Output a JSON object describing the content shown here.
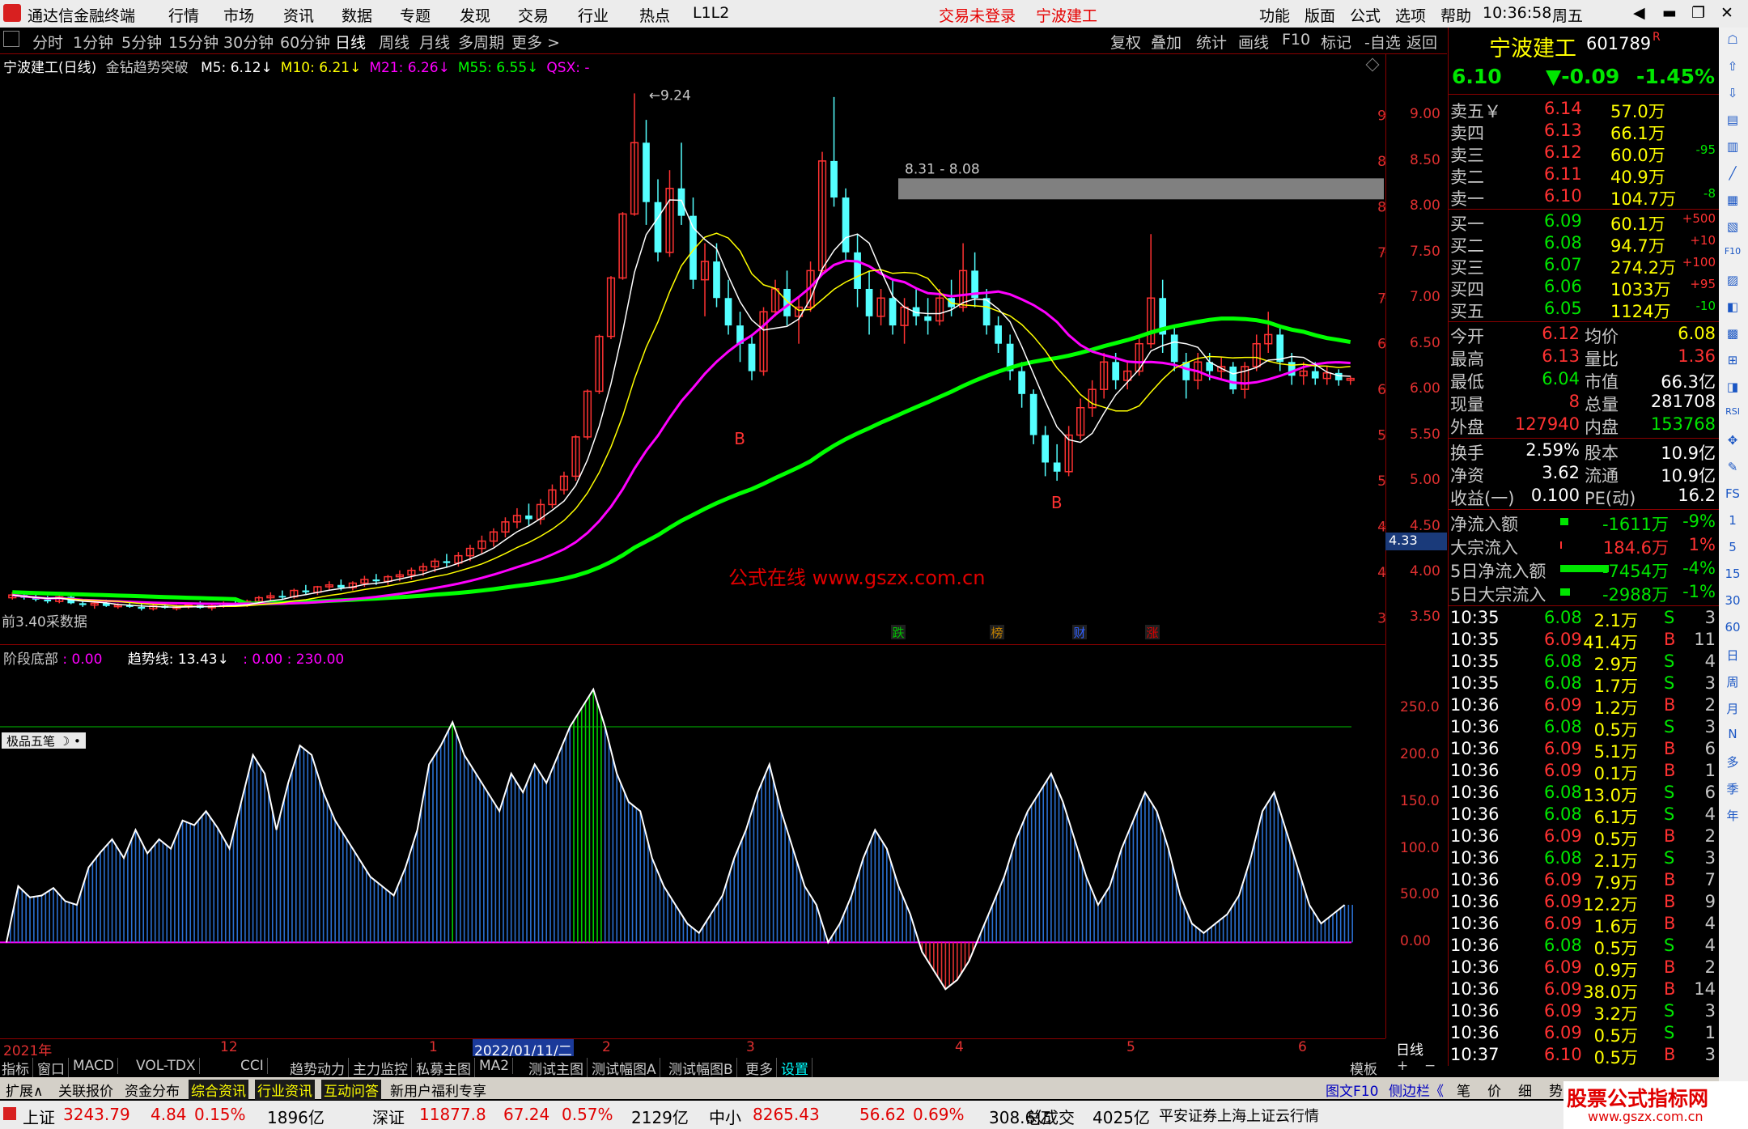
{
  "window": {
    "app_title": "通达信金融终端",
    "menus": [
      "行情",
      "市场",
      "资讯",
      "数据",
      "专题",
      "发现",
      "交易",
      "行业",
      "热点",
      "L1L2"
    ],
    "login_status": "交易未登录",
    "stock_name_title": "宁波建工",
    "right_menus": [
      "功能",
      "版面",
      "公式",
      "选项",
      "帮助"
    ],
    "time": "10:36:58",
    "weekday": "周五",
    "window_controls": [
      "◀",
      "▬",
      "❐",
      "✕"
    ]
  },
  "toolbar": {
    "periods": [
      "分时",
      "1分钟",
      "5分钟",
      "15分钟",
      "30分钟",
      "60分钟",
      "日线",
      "周线",
      "月线",
      "多周期",
      "更多 >"
    ],
    "active_period": "日线",
    "actions": [
      "复权",
      "叠加",
      "统计",
      "画线",
      "F10",
      "标记",
      "-自选",
      "返回"
    ]
  },
  "main_chart": {
    "legend_title": "宁波建工(日线)",
    "indicator_name": "金钻趋势突破",
    "ma": [
      {
        "label": "M5: 6.12↓",
        "color": "#ffffff"
      },
      {
        "label": "M10: 6.21↓",
        "color": "#ffff00"
      },
      {
        "label": "M21: 6.26↓",
        "color": "#ff00ff"
      },
      {
        "label": "M55: 6.55↓",
        "color": "#00ff00"
      },
      {
        "label": "QSX: -",
        "color": "#ff00ff"
      }
    ],
    "peak_label": "9.24",
    "range_label": "8.31 - 8.08",
    "b_marks": [
      "B",
      "B"
    ],
    "watermark": "公式在线  www.gszx.com.cn",
    "bottom_label": "前3.40采数据",
    "price_tag": "4.33",
    "events": [
      {
        "label": "跌",
        "color": "#00c000"
      },
      {
        "label": "榜",
        "color": "#c08000"
      },
      {
        "label": "财",
        "color": "#3060ff"
      },
      {
        "label": "涨",
        "color": "#e00000"
      }
    ],
    "y_ticks": [
      "9.00",
      "8.50",
      "8.00",
      "7.50",
      "7.00",
      "6.50",
      "6.00",
      "5.50",
      "5.00",
      "4.50",
      "4.00",
      "3.50"
    ]
  },
  "sub_chart": {
    "legend_name": "阶段底部",
    "legend_value": ": 0.00",
    "trend_label": "趋势线: 13.43↓",
    "extra": ": 0.00 : 230.00",
    "y_ticks": [
      "250.0",
      "200.0",
      "150.0",
      "100.0",
      "50.00",
      "0.00"
    ],
    "widget_label": "极品五笔"
  },
  "time_axis": [
    "2021年",
    "12",
    "1",
    "2022/01/11/二",
    "2",
    "3",
    "4",
    "5",
    "6"
  ],
  "period_box": "日线",
  "bottom_tabs": [
    "指标",
    "窗口",
    "MACD",
    "VOL-TDX",
    "CCI",
    "趋势动力",
    "主力监控",
    "私募主图",
    "MA2",
    "测试主图",
    "测试幅图A",
    "测试幅图B",
    "更多",
    "设置"
  ],
  "bottom_tabs_right": [
    "模板",
    "+",
    "−"
  ],
  "info_tabs": [
    "扩展∧",
    "关联报价",
    "资金分布",
    "综合资讯",
    "行业资讯",
    "互动问答",
    "新用户福利专享"
  ],
  "info_right": [
    "图文F10",
    "侧边栏《",
    "笔",
    "价",
    "细",
    "势"
  ],
  "quote": {
    "name": "宁波建工",
    "code": "601789",
    "flag": "R",
    "price": "6.10",
    "change": "▼-0.09",
    "pct": "-1.45%",
    "asks": [
      {
        "label": "卖五￥",
        "price": "6.14",
        "vol": "57.0万",
        "chg": ""
      },
      {
        "label": "卖四",
        "price": "6.13",
        "vol": "66.1万",
        "chg": ""
      },
      {
        "label": "卖三",
        "price": "6.12",
        "vol": "60.0万",
        "chg": "-95"
      },
      {
        "label": "卖二",
        "price": "6.11",
        "vol": "40.9万",
        "chg": ""
      },
      {
        "label": "卖一",
        "price": "6.10",
        "vol": "104.7万",
        "chg": "-8"
      }
    ],
    "bids": [
      {
        "label": "买一",
        "price": "6.09",
        "vol": "60.1万",
        "chg": "+500"
      },
      {
        "label": "买二",
        "price": "6.08",
        "vol": "94.7万",
        "chg": "+10"
      },
      {
        "label": "买三",
        "price": "6.07",
        "vol": "274.2万",
        "chg": "+100"
      },
      {
        "label": "买四",
        "price": "6.06",
        "vol": "1033万",
        "chg": "+95"
      },
      {
        "label": "买五",
        "price": "6.05",
        "vol": "1124万",
        "chg": "-10"
      }
    ],
    "stats": [
      {
        "l1": "今开",
        "v1": "6.12",
        "c1": "red",
        "l2": "均价",
        "v2": "6.08",
        "c2": "yellow"
      },
      {
        "l1": "最高",
        "v1": "6.13",
        "c1": "red",
        "l2": "量比",
        "v2": "1.36",
        "c2": "red"
      },
      {
        "l1": "最低",
        "v1": "6.04",
        "c1": "green",
        "l2": "市值",
        "v2": "66.3亿",
        "c2": "white"
      },
      {
        "l1": "现量",
        "v1": "8",
        "c1": "red",
        "l2": "总量",
        "v2": "281708",
        "c2": "white"
      },
      {
        "l1": "外盘",
        "v1": "127940",
        "c1": "red",
        "l2": "内盘",
        "v2": "153768",
        "c2": "green"
      }
    ],
    "stats2": [
      {
        "l1": "换手",
        "v1": "2.59%",
        "l2": "股本",
        "v2": "10.9亿"
      },
      {
        "l1": "净资",
        "v1": "3.62",
        "l2": "流通",
        "v2": "10.9亿"
      },
      {
        "l1": "收益(一)",
        "v1": "0.100",
        "l2": "PE(动)",
        "v2": "16.2"
      }
    ],
    "flows": [
      {
        "label": "净流入额",
        "val": "-1611万",
        "pct": "-9%",
        "bar": 10,
        "color": "green"
      },
      {
        "label": "大宗流入",
        "val": "184.6万",
        "pct": "1%",
        "bar": 2,
        "color": "red"
      },
      {
        "label": "5日净流入额",
        "val": "-7454万",
        "pct": "-4%",
        "bar": 60,
        "color": "green"
      },
      {
        "label": "5日大宗流入",
        "val": "-2988万",
        "pct": "-1%",
        "bar": 12,
        "color": "green"
      }
    ],
    "ticks": [
      {
        "t": "10:35",
        "p": "6.08",
        "v": "2.1万",
        "bs": "S",
        "n": "3"
      },
      {
        "t": "10:35",
        "p": "6.09",
        "v": "41.4万",
        "bs": "B",
        "n": "11"
      },
      {
        "t": "10:35",
        "p": "6.08",
        "v": "2.9万",
        "bs": "S",
        "n": "4"
      },
      {
        "t": "10:35",
        "p": "6.08",
        "v": "1.7万",
        "bs": "S",
        "n": "3"
      },
      {
        "t": "10:36",
        "p": "6.09",
        "v": "1.2万",
        "bs": "B",
        "n": "2"
      },
      {
        "t": "10:36",
        "p": "6.08",
        "v": "0.5万",
        "bs": "S",
        "n": "3"
      },
      {
        "t": "10:36",
        "p": "6.09",
        "v": "5.1万",
        "bs": "B",
        "n": "6"
      },
      {
        "t": "10:36",
        "p": "6.09",
        "v": "0.1万",
        "bs": "B",
        "n": "1"
      },
      {
        "t": "10:36",
        "p": "6.08",
        "v": "13.0万",
        "bs": "S",
        "n": "6"
      },
      {
        "t": "10:36",
        "p": "6.08",
        "v": "6.1万",
        "bs": "S",
        "n": "4"
      },
      {
        "t": "10:36",
        "p": "6.09",
        "v": "0.5万",
        "bs": "B",
        "n": "2"
      },
      {
        "t": "10:36",
        "p": "6.08",
        "v": "2.1万",
        "bs": "S",
        "n": "3"
      },
      {
        "t": "10:36",
        "p": "6.09",
        "v": "7.9万",
        "bs": "B",
        "n": "7"
      },
      {
        "t": "10:36",
        "p": "6.09",
        "v": "12.2万",
        "bs": "B",
        "n": "9"
      },
      {
        "t": "10:36",
        "p": "6.09",
        "v": "1.6万",
        "bs": "B",
        "n": "4"
      },
      {
        "t": "10:36",
        "p": "6.08",
        "v": "0.5万",
        "bs": "S",
        "n": "4"
      },
      {
        "t": "10:36",
        "p": "6.09",
        "v": "0.9万",
        "bs": "B",
        "n": "2"
      },
      {
        "t": "10:36",
        "p": "6.09",
        "v": "38.0万",
        "bs": "B",
        "n": "14"
      },
      {
        "t": "10:36",
        "p": "6.09",
        "v": "3.2万",
        "bs": "S",
        "n": "3"
      },
      {
        "t": "10:36",
        "p": "6.09",
        "v": "0.5万",
        "bs": "S",
        "n": "1"
      },
      {
        "t": "10:37",
        "p": "6.10",
        "v": "0.5万",
        "bs": "B",
        "n": "3"
      }
    ]
  },
  "side_icons": [
    "☖",
    "⇧",
    "⇩",
    "▤",
    "▥",
    "╱",
    "▦",
    "▧",
    "F10",
    "▨",
    "◧",
    "▩",
    "⊞",
    "◨",
    "RSI",
    "✥",
    "✎",
    "FS",
    "1",
    "5",
    "15",
    "30",
    "60",
    "日",
    "周",
    "月",
    "N",
    "多",
    "季",
    "年"
  ],
  "status_bar": {
    "items": [
      {
        "name": "上证",
        "val": "3243.79",
        "chg": "4.84",
        "pct": "0.15%",
        "amt": "1896亿"
      },
      {
        "name": "深证",
        "val": "11877.8",
        "chg": "67.24",
        "pct": "0.57%",
        "amt": "2129亿"
      },
      {
        "name": "中小",
        "val": "8265.43",
        "chg": "56.62",
        "pct": "0.69%",
        "amt": "308.6亿"
      }
    ],
    "total_label": "总成交",
    "total": "4025亿",
    "server": "平安证券上海上证云行情",
    "logo_text": "股票公式指标网",
    "logo_url": "www.gszx.com.cn"
  },
  "chart_data": {
    "type": "candlestick",
    "ylim": [
      3.3,
      9.5
    ],
    "candles": [
      [
        3.72,
        3.78,
        3.7,
        3.75
      ],
      [
        3.75,
        3.77,
        3.7,
        3.72
      ],
      [
        3.72,
        3.76,
        3.68,
        3.7
      ],
      [
        3.7,
        3.74,
        3.66,
        3.68
      ],
      [
        3.68,
        3.75,
        3.66,
        3.73
      ],
      [
        3.73,
        3.76,
        3.65,
        3.66
      ],
      [
        3.66,
        3.7,
        3.62,
        3.64
      ],
      [
        3.64,
        3.68,
        3.6,
        3.66
      ],
      [
        3.66,
        3.7,
        3.62,
        3.63
      ],
      [
        3.63,
        3.66,
        3.6,
        3.64
      ],
      [
        3.64,
        3.68,
        3.61,
        3.62
      ],
      [
        3.62,
        3.66,
        3.58,
        3.6
      ],
      [
        3.6,
        3.65,
        3.58,
        3.63
      ],
      [
        3.63,
        3.67,
        3.6,
        3.61
      ],
      [
        3.61,
        3.64,
        3.58,
        3.62
      ],
      [
        3.62,
        3.66,
        3.6,
        3.64
      ],
      [
        3.64,
        3.68,
        3.6,
        3.61
      ],
      [
        3.61,
        3.65,
        3.58,
        3.63
      ],
      [
        3.63,
        3.68,
        3.61,
        3.66
      ],
      [
        3.66,
        3.7,
        3.62,
        3.64
      ],
      [
        3.64,
        3.7,
        3.62,
        3.68
      ],
      [
        3.68,
        3.74,
        3.65,
        3.72
      ],
      [
        3.72,
        3.78,
        3.68,
        3.74
      ],
      [
        3.74,
        3.8,
        3.7,
        3.73
      ],
      [
        3.73,
        3.82,
        3.71,
        3.8
      ],
      [
        3.8,
        3.86,
        3.76,
        3.78
      ],
      [
        3.78,
        3.85,
        3.75,
        3.84
      ],
      [
        3.84,
        3.9,
        3.8,
        3.86
      ],
      [
        3.86,
        3.92,
        3.8,
        3.83
      ],
      [
        3.83,
        3.9,
        3.8,
        3.88
      ],
      [
        3.88,
        3.96,
        3.84,
        3.92
      ],
      [
        3.92,
        3.98,
        3.86,
        3.9
      ],
      [
        3.9,
        3.97,
        3.86,
        3.95
      ],
      [
        3.95,
        4.02,
        3.9,
        3.97
      ],
      [
        3.97,
        4.05,
        3.92,
        4.02
      ],
      [
        4.02,
        4.1,
        3.96,
        4.06
      ],
      [
        4.06,
        4.15,
        4.0,
        4.12
      ],
      [
        4.12,
        4.2,
        4.05,
        4.1
      ],
      [
        4.1,
        4.22,
        4.06,
        4.18
      ],
      [
        4.18,
        4.3,
        4.12,
        4.26
      ],
      [
        4.26,
        4.4,
        4.2,
        4.34
      ],
      [
        4.34,
        4.48,
        4.28,
        4.44
      ],
      [
        4.44,
        4.6,
        4.38,
        4.55
      ],
      [
        4.55,
        4.7,
        4.48,
        4.62
      ],
      [
        4.62,
        4.75,
        4.5,
        4.58
      ],
      [
        4.58,
        4.8,
        4.52,
        4.74
      ],
      [
        4.74,
        4.96,
        4.7,
        4.9
      ],
      [
        4.9,
        5.1,
        4.85,
        5.05
      ],
      [
        5.05,
        5.5,
        5.0,
        5.48
      ],
      [
        5.48,
        6.0,
        5.45,
        5.98
      ],
      [
        5.98,
        6.6,
        5.95,
        6.58
      ],
      [
        6.58,
        7.24,
        6.55,
        7.22
      ],
      [
        7.22,
        7.94,
        7.2,
        7.92
      ],
      [
        7.92,
        9.24,
        7.9,
        8.7
      ],
      [
        8.7,
        8.95,
        7.8,
        8.05
      ],
      [
        8.05,
        8.3,
        7.4,
        7.5
      ],
      [
        7.5,
        8.4,
        7.45,
        8.2
      ],
      [
        8.2,
        8.7,
        7.8,
        7.9
      ],
      [
        7.9,
        8.1,
        7.1,
        7.2
      ],
      [
        7.2,
        7.6,
        6.8,
        7.4
      ],
      [
        7.4,
        7.6,
        6.9,
        7.0
      ],
      [
        7.0,
        7.2,
        6.6,
        6.7
      ],
      [
        6.7,
        6.85,
        6.3,
        6.5
      ],
      [
        6.5,
        6.6,
        6.1,
        6.2
      ],
      [
        6.2,
        6.9,
        6.15,
        6.85
      ],
      [
        6.85,
        7.2,
        6.8,
        7.1
      ],
      [
        7.1,
        7.3,
        6.7,
        6.8
      ],
      [
        6.8,
        7.0,
        6.5,
        6.9
      ],
      [
        6.9,
        7.4,
        6.85,
        7.3
      ],
      [
        7.3,
        8.6,
        7.25,
        8.5
      ],
      [
        8.5,
        9.2,
        8.0,
        8.1
      ],
      [
        8.1,
        8.2,
        7.4,
        7.5
      ],
      [
        7.5,
        7.7,
        6.9,
        7.1
      ],
      [
        7.1,
        7.3,
        6.6,
        6.8
      ],
      [
        6.8,
        7.1,
        6.7,
        7.0
      ],
      [
        7.0,
        7.2,
        6.6,
        6.7
      ],
      [
        6.7,
        7.0,
        6.5,
        6.9
      ],
      [
        6.9,
        7.1,
        6.7,
        6.8
      ],
      [
        6.8,
        7.0,
        6.6,
        6.75
      ],
      [
        6.75,
        7.1,
        6.7,
        7.0
      ],
      [
        7.0,
        7.2,
        6.8,
        6.9
      ],
      [
        6.9,
        7.6,
        6.85,
        7.3
      ],
      [
        7.3,
        7.5,
        6.9,
        7.0
      ],
      [
        7.0,
        7.1,
        6.6,
        6.7
      ],
      [
        6.7,
        6.8,
        6.4,
        6.5
      ],
      [
        6.5,
        6.6,
        6.1,
        6.2
      ],
      [
        6.2,
        6.3,
        5.8,
        5.95
      ],
      [
        5.95,
        6.0,
        5.4,
        5.5
      ],
      [
        5.5,
        5.6,
        5.05,
        5.2
      ],
      [
        5.2,
        5.4,
        5.0,
        5.1
      ],
      [
        5.1,
        5.6,
        5.05,
        5.5
      ],
      [
        5.5,
        5.9,
        5.45,
        5.8
      ],
      [
        5.8,
        6.1,
        5.7,
        6.0
      ],
      [
        6.0,
        6.4,
        5.9,
        6.3
      ],
      [
        6.3,
        6.4,
        6.0,
        6.1
      ],
      [
        6.1,
        6.3,
        6.0,
        6.2
      ],
      [
        6.2,
        6.6,
        6.15,
        6.5
      ],
      [
        6.5,
        7.7,
        6.45,
        7.0
      ],
      [
        7.0,
        7.2,
        6.4,
        6.6
      ],
      [
        6.6,
        6.7,
        6.2,
        6.3
      ],
      [
        6.3,
        6.4,
        5.9,
        6.1
      ],
      [
        6.1,
        6.4,
        6.0,
        6.3
      ],
      [
        6.3,
        6.4,
        6.1,
        6.2
      ],
      [
        6.2,
        6.35,
        6.1,
        6.25
      ],
      [
        6.25,
        6.3,
        5.95,
        6.0
      ],
      [
        6.0,
        6.3,
        5.9,
        6.25
      ],
      [
        6.25,
        6.6,
        6.2,
        6.5
      ],
      [
        6.5,
        6.85,
        6.4,
        6.6
      ],
      [
        6.6,
        6.7,
        6.2,
        6.3
      ],
      [
        6.3,
        6.4,
        6.05,
        6.15
      ],
      [
        6.15,
        6.3,
        6.05,
        6.2
      ],
      [
        6.2,
        6.3,
        6.05,
        6.12
      ],
      [
        6.12,
        6.25,
        6.05,
        6.18
      ],
      [
        6.18,
        6.22,
        6.04,
        6.1
      ],
      [
        6.1,
        6.15,
        6.05,
        6.12
      ]
    ],
    "ma5_end": 6.12,
    "ma10_end": 6.21,
    "ma21_end": 6.26,
    "ma55_end": 6.55,
    "sub_values": [
      0,
      60,
      48,
      50,
      58,
      44,
      40,
      80,
      96,
      110,
      90,
      120,
      95,
      110,
      100,
      130,
      125,
      140,
      122,
      100,
      150,
      200,
      180,
      120,
      170,
      210,
      200,
      160,
      130,
      110,
      90,
      70,
      60,
      50,
      80,
      120,
      190,
      210,
      235,
      200,
      180,
      160,
      140,
      180,
      160,
      190,
      170,
      200,
      230,
      250,
      270,
      230,
      180,
      150,
      140,
      90,
      60,
      40,
      20,
      10,
      30,
      50,
      90,
      120,
      160,
      190,
      140,
      100,
      60,
      40,
      0,
      20,
      50,
      90,
      120,
      100,
      60,
      30,
      -10,
      -30,
      -50,
      -40,
      -20,
      10,
      40,
      70,
      110,
      140,
      160,
      180,
      150,
      110,
      70,
      40,
      60,
      100,
      130,
      160,
      140,
      100,
      50,
      20,
      10,
      20,
      30,
      50,
      90,
      140,
      160,
      120,
      80,
      40,
      20,
      30,
      40
    ]
  }
}
